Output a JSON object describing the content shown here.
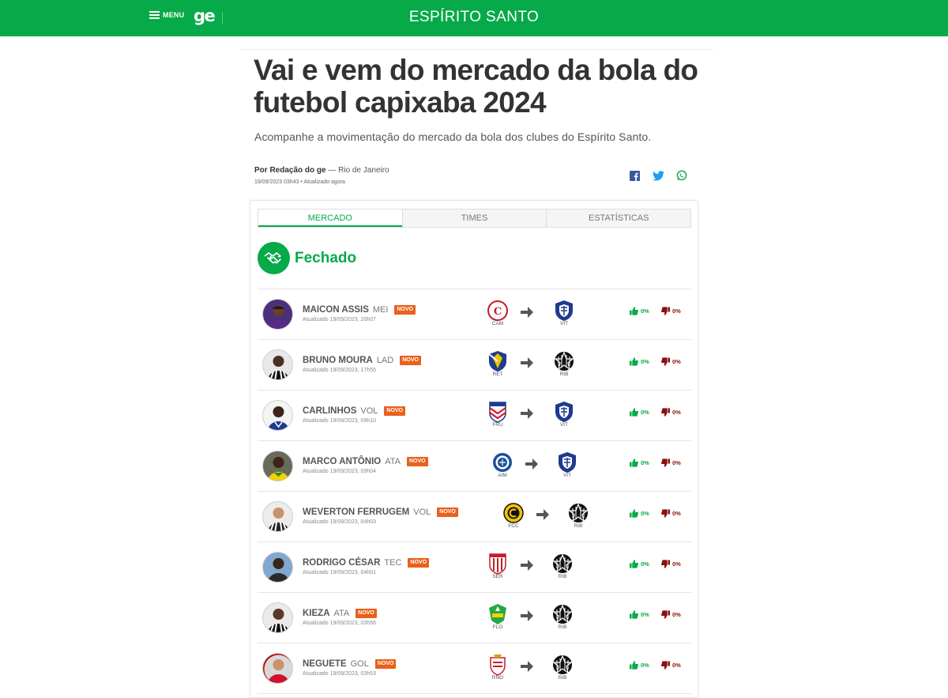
{
  "header": {
    "menu_label": "MENU",
    "logo_text": "ge",
    "section_title": "ESPÍRITO SANTO",
    "brand_color": "#06aa48"
  },
  "article": {
    "title": "Vai e vem do mercado da bola do futebol capixaba 2024",
    "subtitle": "Acompanhe a movimentação do mercado da bola dos clubes do Espírito Santo.",
    "byline_author": "Por Redação do ge",
    "byline_location": " — Rio de Janeiro",
    "dateline": "19/09/2023 03h43 • Atualizado agora",
    "share_icons": [
      "facebook-icon",
      "twitter-icon",
      "whatsapp-icon"
    ]
  },
  "tabs": [
    {
      "label": "MERCADO",
      "active": true
    },
    {
      "label": "TIMES",
      "active": false
    },
    {
      "label": "ESTATÍSTICAS",
      "active": false
    }
  ],
  "status": {
    "label": "Fechado",
    "icon": "handshake-icon"
  },
  "transfers": [
    {
      "name": "MAICON ASSIS",
      "position": "MEI",
      "badge": "NOVO",
      "updated": "Atualizado 19/09/2023, 20h07",
      "from": "CAM",
      "to": "VIT",
      "likes": "0%",
      "dislikes": "0%"
    },
    {
      "name": "BRUNO MOURA",
      "position": "LAD",
      "badge": "NOVO",
      "updated": "Atualizado 19/09/2023, 17h55",
      "from": "RET",
      "to": "RIB",
      "likes": "0%",
      "dislikes": "0%"
    },
    {
      "name": "CARLINHOS",
      "position": "VOL",
      "badge": "NOVO",
      "updated": "Atualizado 19/09/2023, 09h10",
      "from": "FRU",
      "to": "VIT",
      "likes": "0%",
      "dislikes": "0%"
    },
    {
      "name": "MARCO ANTÔNIO",
      "position": "ATA",
      "badge": "NOVO",
      "updated": "Atualizado 19/09/2023, 09h04",
      "from": "AIM",
      "to": "VIT",
      "likes": "0%",
      "dislikes": "0%"
    },
    {
      "name": "WEVERTON FERRUGEM",
      "position": "VOL",
      "badge": "NOVO",
      "updated": "Atualizado 19/09/2023, 04h03",
      "from": "FCC",
      "to": "RIB",
      "likes": "0%",
      "dislikes": "0%"
    },
    {
      "name": "RODRIGO CÉSAR",
      "position": "TEC",
      "badge": "NOVO",
      "updated": "Atualizado 19/09/2023, 04h01",
      "from": "SER",
      "to": "RIB",
      "likes": "0%",
      "dislikes": "0%"
    },
    {
      "name": "KIEZA",
      "position": "ATA",
      "badge": "NOVO",
      "updated": "Atualizado 19/09/2023, 03h56",
      "from": "FLO",
      "to": "RIB",
      "likes": "0%",
      "dislikes": "0%"
    },
    {
      "name": "NEGUETE",
      "position": "GOL",
      "badge": "NOVO",
      "updated": "Atualizado 19/09/2023, 03h53",
      "from": "RNO",
      "to": "RIB",
      "likes": "0%",
      "dislikes": "0%"
    }
  ],
  "colors": {
    "badge": "#e9611b",
    "like": "#06aa48",
    "dislike": "#8a1010"
  }
}
